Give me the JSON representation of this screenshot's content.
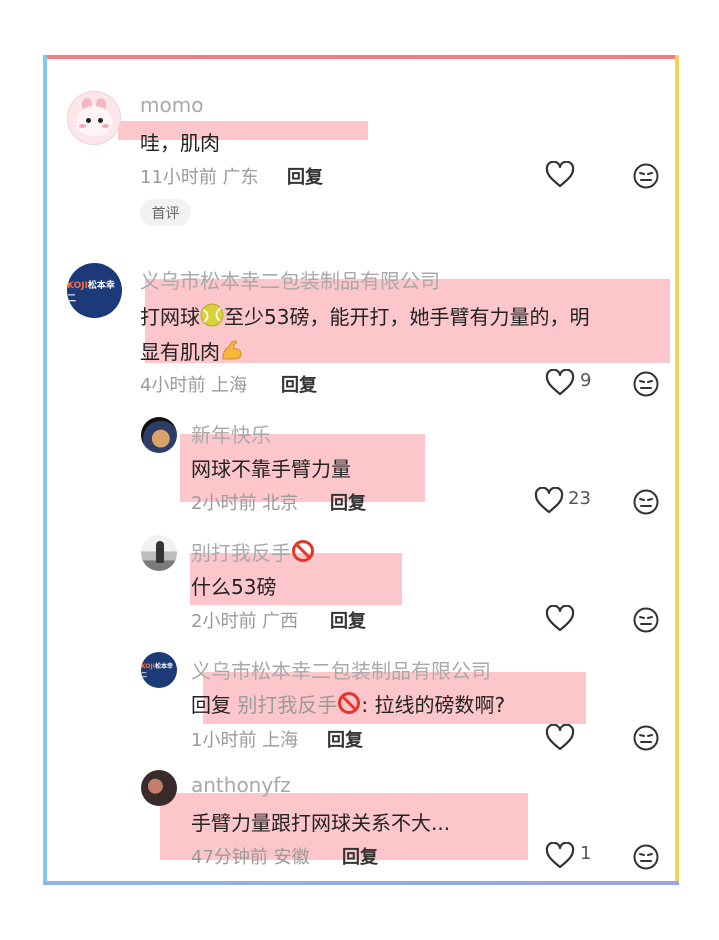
{
  "comments": [
    {
      "user": "momo",
      "text": "哇，肌肉",
      "time": "11小时前 广东",
      "reply": "回复",
      "badge": "首评",
      "likes": ""
    },
    {
      "user": "义乌市松本幸二包装制品有限公司",
      "text_a": "打网球",
      "text_b": "至少53磅，能开打，她手臂有力量的，明",
      "text_c": "显有肌肉",
      "time": "4小时前 上海",
      "reply": "回复",
      "likes": "9",
      "avatar_logo": "KOJI",
      "avatar_sub": "松本幸二"
    }
  ],
  "replies": [
    {
      "user": "新年快乐",
      "text": "网球不靠手臂力量",
      "time": "2小时前 北京",
      "reply": "回复",
      "likes": "23"
    },
    {
      "user": "别打我反手",
      "text": "什么53磅",
      "time": "2小时前 广西",
      "reply": "回复",
      "likes": ""
    },
    {
      "user": "义乌市松本幸二包装制品有限公司",
      "reply_prefix": "回复",
      "mention": "别打我反手",
      "text": ": 拉线的磅数啊?",
      "time": "1小时前 上海",
      "reply": "回复",
      "likes": "",
      "avatar_logo": "KOJI",
      "avatar_sub": "松本幸二"
    },
    {
      "user": "anthonyfz",
      "text": "手臂力量跟打网球关系不大...",
      "time": "47分钟前 安徽",
      "reply": "回复",
      "likes": "1"
    }
  ],
  "icons": {
    "like": "heart-outline-icon",
    "more": "neutral-face-icon",
    "tennis": "tennis-ball-emoji",
    "muscle": "flexed-biceps-emoji",
    "prohibited": "prohibited-emoji"
  },
  "colors": {
    "highlight": "#faa0a8",
    "frame_top": "#ee7d8c",
    "frame_left": "#7fc9ee",
    "frame_right": "#f7d259",
    "frame_bottom": "#8fb4ee"
  }
}
